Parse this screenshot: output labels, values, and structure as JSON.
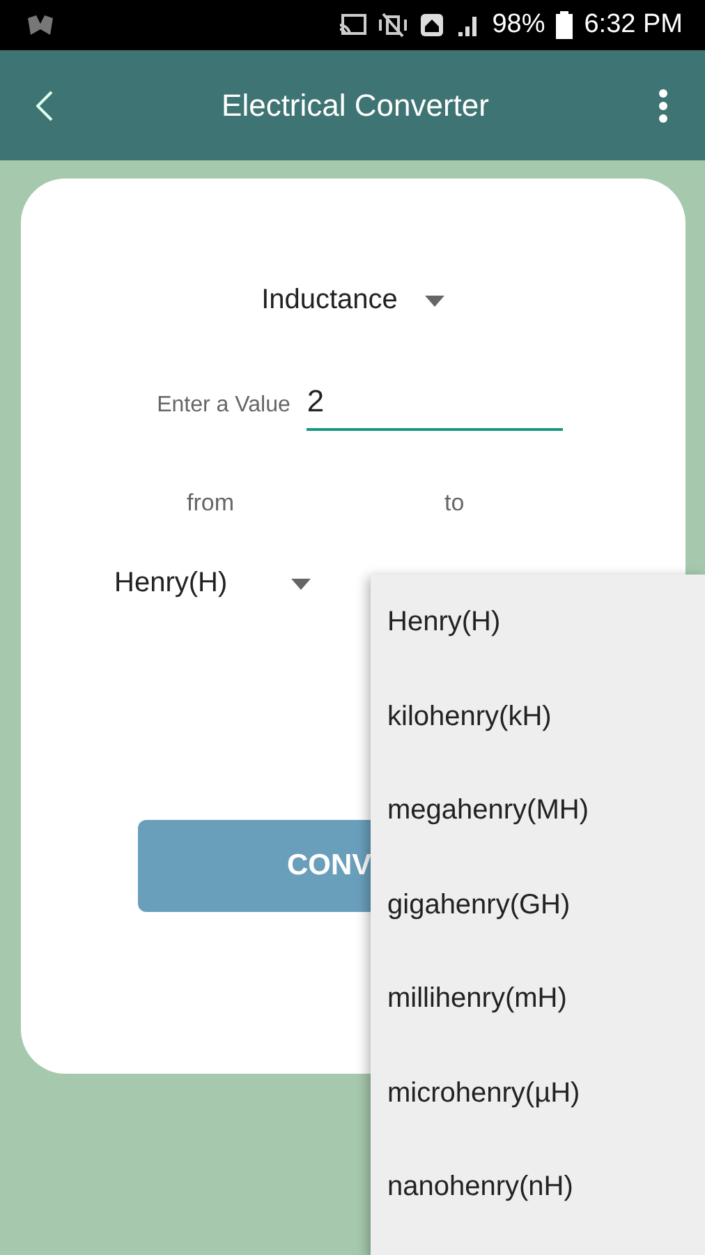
{
  "status_bar": {
    "battery": "98%",
    "time": "6:32 PM"
  },
  "app_bar": {
    "title": "Electrical Converter"
  },
  "category": {
    "value": "Inductance"
  },
  "value_field": {
    "label": "Enter a Value",
    "value": "2"
  },
  "from_label": "from",
  "to_label": "to",
  "from_unit": {
    "value": "Henry(H)"
  },
  "convert_button": {
    "label": "CONV"
  },
  "unit_menu": {
    "items": [
      {
        "label": "Henry(H)"
      },
      {
        "label": "kilohenry(kH)"
      },
      {
        "label": "megahenry(MH)"
      },
      {
        "label": "gigahenry(GH)"
      },
      {
        "label": "millihenry(mH)"
      },
      {
        "label": "microhenry(µH)"
      },
      {
        "label": "nanohenry(nH)"
      }
    ]
  }
}
